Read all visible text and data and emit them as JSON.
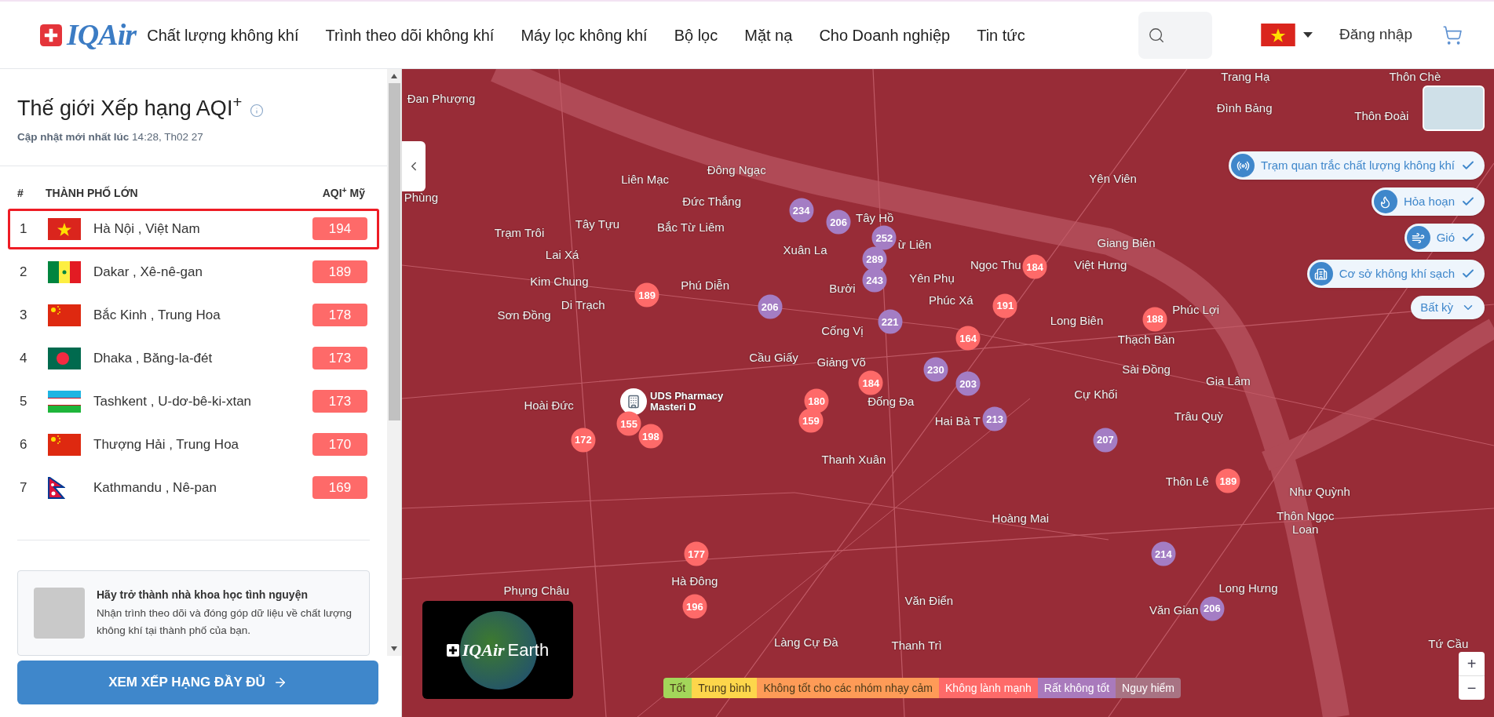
{
  "header": {
    "logo": "IQAir",
    "nav": [
      "Chất lượng không khí",
      "Trình theo dõi không khí",
      "Máy lọc không khí",
      "Bộ lọc",
      "Mặt nạ",
      "Cho Doanh nghiệp",
      "Tin tức"
    ],
    "login": "Đăng nhập"
  },
  "ranking": {
    "title": "Thế giới Xếp hạng AQI$^{+}$",
    "updated": "**Cập nhật mới nhất lúc** 14:28, Th02 27",
    "columns": [
      "#",
      "THÀNH PHỐ LỚN",
      "AQI$^{+}$ Mỹ"
    ],
    "rows": [
      {
        "rank": "1",
        "city": "Hà Nội , Việt Nam",
        "aqi": "194",
        "selected": true
      },
      {
        "rank": "2",
        "city": "Dakar , Xê-nê-gan",
        "aqi": "189",
        "selected": false
      },
      {
        "rank": "3",
        "city": "Bắc Kinh , Trung Hoa",
        "aqi": "178",
        "selected": false
      },
      {
        "rank": "4",
        "city": "Dhaka , Băng-la-đét",
        "aqi": "173",
        "selected": false
      },
      {
        "rank": "5",
        "city": "Tashkent , U-dơ-bê-ki-xtan",
        "aqi": "173",
        "selected": false
      },
      {
        "rank": "6",
        "city": "Thượng Hải , Trung Hoa",
        "aqi": "170",
        "selected": false
      },
      {
        "rank": "7",
        "city": "Kathmandu , Nê-pan",
        "aqi": "169",
        "selected": false
      }
    ],
    "volunteer": {
      "title": "Hãy trở thành nhà khoa học tình nguyện",
      "text": "Nhận trình theo dõi và đóng góp dữ liệu về chất lượng không khí tại thành phố của bạn."
    },
    "button": "XEM XẾP HẠNG ĐẦY ĐỦ"
  },
  "map": {
    "labels": [
      "Đan Phượng",
      "Trang Hạ",
      "Thôn Chè",
      "Đình Bảng",
      "Thôn Đoài",
      "Phùng",
      "Liên Mạc",
      "Đông Ngạc",
      "Đức Thắng",
      "Yên Viên",
      "Tây Tựu",
      "Bắc Từ Liêm",
      "Tây Hồ",
      "Trạm Trôi",
      "Xuân La",
      "ừ Liên",
      "Giang Biên",
      "Lai Xá",
      "Ngọc Thu",
      "Việt Hưng",
      "Kim Chung",
      "Yên Phụ",
      "Phú Diễn",
      "Bưởi",
      "Phúc Xá",
      "Di Trạch",
      "Long Biên",
      "Phúc Lợi",
      "Sơn Đồng",
      "Cống Vị",
      "Thạch Bàn",
      "Cầu Giấy",
      "Giảng Võ",
      "Sài Đồng",
      "Gia Lâm",
      "Cự Khối",
      "Đống Đa",
      "Hoài Đức",
      "Hai Bà T",
      "Trâu Quỳ",
      "Thanh Xuân",
      "Thôn Lê",
      "Như Quỳnh",
      "Hoàng Mai",
      "Thôn Ngọc Loan",
      "Hà Đông",
      "Long Hưng",
      "Phụng Châu",
      "Văn Điển",
      "Văn Gian",
      "Làng Cự Đà",
      "Thanh Trì",
      "Tứ Cầu"
    ],
    "markers": [
      {
        "value": "234",
        "color": "#a47dc4"
      },
      {
        "value": "206",
        "color": "#a47dc4"
      },
      {
        "value": "252",
        "color": "#a47dc4"
      },
      {
        "value": "289",
        "color": "#a47dc4"
      },
      {
        "value": "243",
        "color": "#a47dc4"
      },
      {
        "value": "206",
        "color": "#a47dc4"
      },
      {
        "value": "189",
        "color": "#fe6a69"
      },
      {
        "value": "221",
        "color": "#a47dc4"
      },
      {
        "value": "164",
        "color": "#fe6a69"
      },
      {
        "value": "184",
        "color": "#fe6a69"
      },
      {
        "value": "230",
        "color": "#a47dc4"
      },
      {
        "value": "203",
        "color": "#a47dc4"
      },
      {
        "value": "180",
        "color": "#fe6a69"
      },
      {
        "value": "159",
        "color": "#fe6a69"
      },
      {
        "value": "213",
        "color": "#a47dc4"
      },
      {
        "value": "184",
        "color": "#fe6a69"
      },
      {
        "value": "191",
        "color": "#fe6a69"
      },
      {
        "value": "188",
        "color": "#fe6a69"
      },
      {
        "value": "207",
        "color": "#a47dc4"
      },
      {
        "value": "189",
        "color": "#fe6a69"
      },
      {
        "value": "214",
        "color": "#a47dc4"
      },
      {
        "value": "206",
        "color": "#a47dc4"
      },
      {
        "value": "177",
        "color": "#fe6a69"
      },
      {
        "value": "196",
        "color": "#fe6a69"
      },
      {
        "value": "172",
        "color": "#fe6a69"
      },
      {
        "value": "155",
        "color": "#fe6a69"
      },
      {
        "value": "198",
        "color": "#fe6a69"
      }
    ],
    "place_pin": [
      "UDS Pharmacy",
      "Masteri D"
    ],
    "layers": [
      {
        "label": "Trạm quan trắc chất lượng không khí",
        "checked": true
      },
      {
        "label": "Hỏa hoạn",
        "checked": true
      },
      {
        "label": "Gió",
        "checked": true
      },
      {
        "label": "Cơ sở không khí sạch",
        "checked": true
      }
    ],
    "filter": "Bất kỳ",
    "earth": {
      "brand": "IQAir",
      "label": "Earth"
    },
    "legend": [
      {
        "label": "Tốt",
        "color": "#a3d65a"
      },
      {
        "label": "Trung bình",
        "color": "#fdd64b"
      },
      {
        "label": "Không tốt cho các nhóm nhạy cảm",
        "color": "#fe9b57"
      },
      {
        "label": "Không lành mạnh",
        "color": "#fe6a69"
      },
      {
        "label": "Rất không tốt",
        "color": "#a97abc"
      },
      {
        "label": "Nguy hiểm",
        "color": "#a87383"
      }
    ],
    "zoom": [
      "+",
      "−"
    ]
  }
}
